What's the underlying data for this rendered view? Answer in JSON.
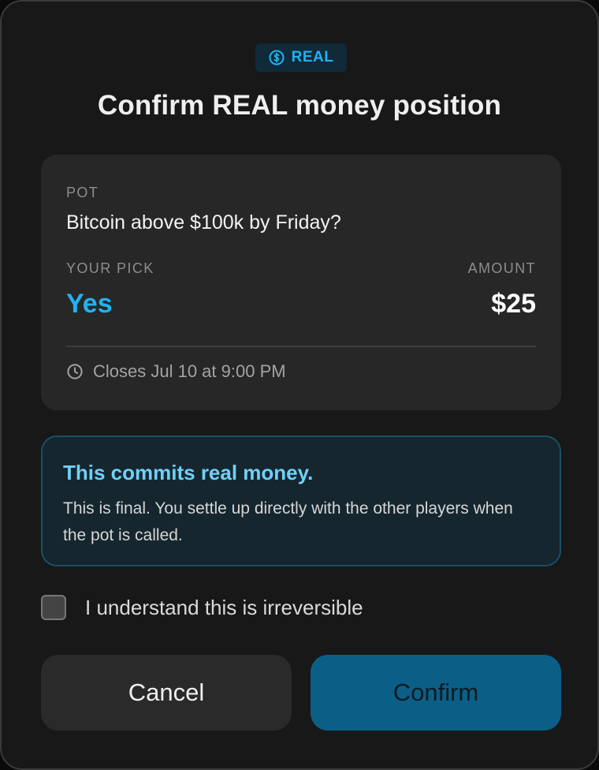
{
  "badge": {
    "label": "REAL",
    "icon": "dollar-coin-icon"
  },
  "title": "Confirm REAL money position",
  "pot": {
    "label": "POT",
    "question": "Bitcoin above $100k by Friday?",
    "pick_label": "YOUR PICK",
    "pick_value": "Yes",
    "amount_label": "AMOUNT",
    "amount_value": "$25",
    "closes_icon": "clock-icon",
    "closes_text": "Closes Jul 10 at 9:00 PM"
  },
  "warning": {
    "title": "This commits real money.",
    "body": "This is final. You settle up directly with the other players when the pot is called."
  },
  "acknowledge": {
    "label": "I understand this is irreversible",
    "checked": false
  },
  "actions": {
    "cancel_label": "Cancel",
    "confirm_label": "Confirm"
  },
  "colors": {
    "accent": "#1fb3f3",
    "warning_title": "#6fd1f9",
    "confirm_bg": "#0b5f86",
    "modal_bg": "#181818",
    "card_bg": "#272727"
  }
}
